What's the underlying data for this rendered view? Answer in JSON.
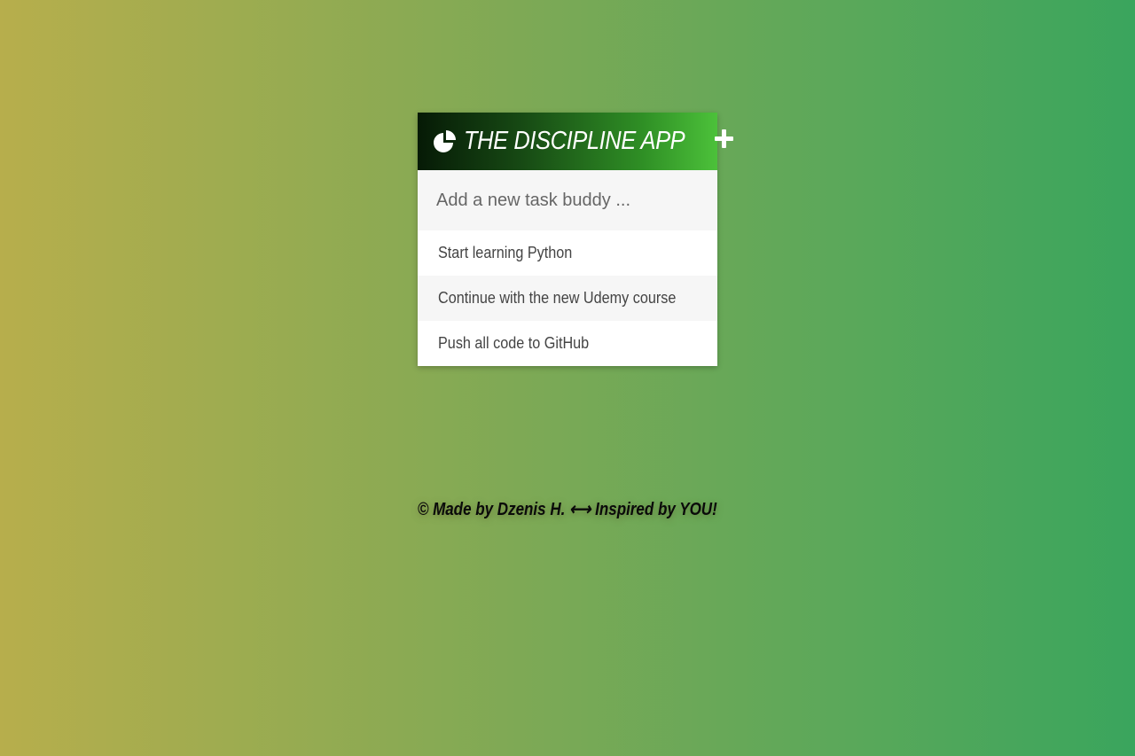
{
  "app": {
    "title": "THE DISCIPLINE APP",
    "logo_icon": "pie-chart-icon",
    "add_icon": "plus-icon"
  },
  "new_task": {
    "placeholder": "Add a new task buddy ...",
    "value": ""
  },
  "tasks": [
    {
      "text": "Start learning Python"
    },
    {
      "text": "Continue with the new Udemy course"
    },
    {
      "text": "Push all code to GitHub"
    }
  ],
  "footer": {
    "text": "© Made by Dzenis H. ⟷ Inspired by YOU!"
  },
  "colors": {
    "background_left": "#b7ae4c",
    "background_right": "#3aa55d",
    "header_dark": "#061a06",
    "header_bright": "#4cc13a"
  }
}
